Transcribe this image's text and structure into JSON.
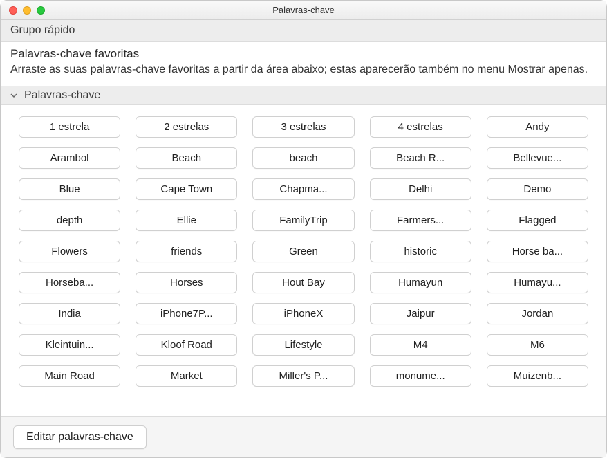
{
  "window": {
    "title": "Palavras-chave"
  },
  "sections": {
    "quick_group": "Grupo rápido",
    "favorites_title": "Palavras-chave favoritas",
    "favorites_desc": "Arraste as suas palavras-chave favoritas a partir da área abaixo; estas aparecerão também no menu Mostrar apenas.",
    "keywords_label": "Palavras-chave"
  },
  "keywords": [
    "1 estrela",
    "2 estrelas",
    "3 estrelas",
    "4 estrelas",
    "Andy",
    "Arambol",
    "Beach",
    "beach",
    "Beach R...",
    "Bellevue...",
    "Blue",
    "Cape Town",
    "Chapma...",
    "Delhi",
    "Demo",
    "depth",
    "Ellie",
    "FamilyTrip",
    "Farmers...",
    "Flagged",
    "Flowers",
    "friends",
    "Green",
    "historic",
    "Horse ba...",
    "Horseba...",
    "Horses",
    "Hout Bay",
    "Humayun",
    "Humayu...",
    "India",
    "iPhone7P...",
    "iPhoneX",
    "Jaipur",
    "Jordan",
    "Kleintuin...",
    "Kloof Road",
    "Lifestyle",
    "M4",
    "M6",
    "Main Road",
    "Market",
    "Miller's P...",
    "monume...",
    "Muizenb..."
  ],
  "footer": {
    "edit_label": "Editar palavras-chave"
  }
}
